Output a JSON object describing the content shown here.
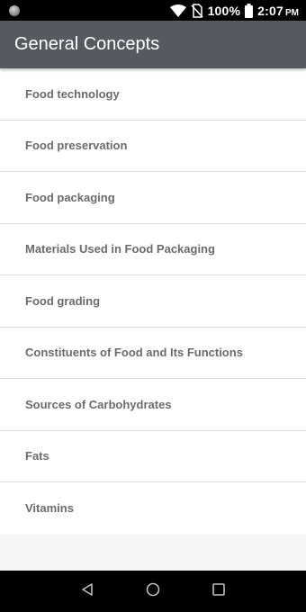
{
  "status_bar": {
    "battery": "100%",
    "time": "2:07",
    "ampm": "PM"
  },
  "app_bar": {
    "title": "General Concepts"
  },
  "list": {
    "items": [
      {
        "label": "Food technology"
      },
      {
        "label": "Food preservation"
      },
      {
        "label": "Food packaging"
      },
      {
        "label": "Materials Used in Food Packaging"
      },
      {
        "label": "Food grading"
      },
      {
        "label": "Constituents of Food and Its Functions"
      },
      {
        "label": "Sources of Carbohydrates"
      },
      {
        "label": "Fats"
      },
      {
        "label": "Vitamins"
      }
    ]
  },
  "colors": {
    "app_bar": "#555a60",
    "list_text": "#6b6b6b",
    "background": "#f5f5f5"
  },
  "icons": [
    "notification-dot-icon",
    "wifi-icon",
    "no-sim-icon",
    "battery-icon",
    "back-icon",
    "home-icon",
    "recents-icon"
  ]
}
